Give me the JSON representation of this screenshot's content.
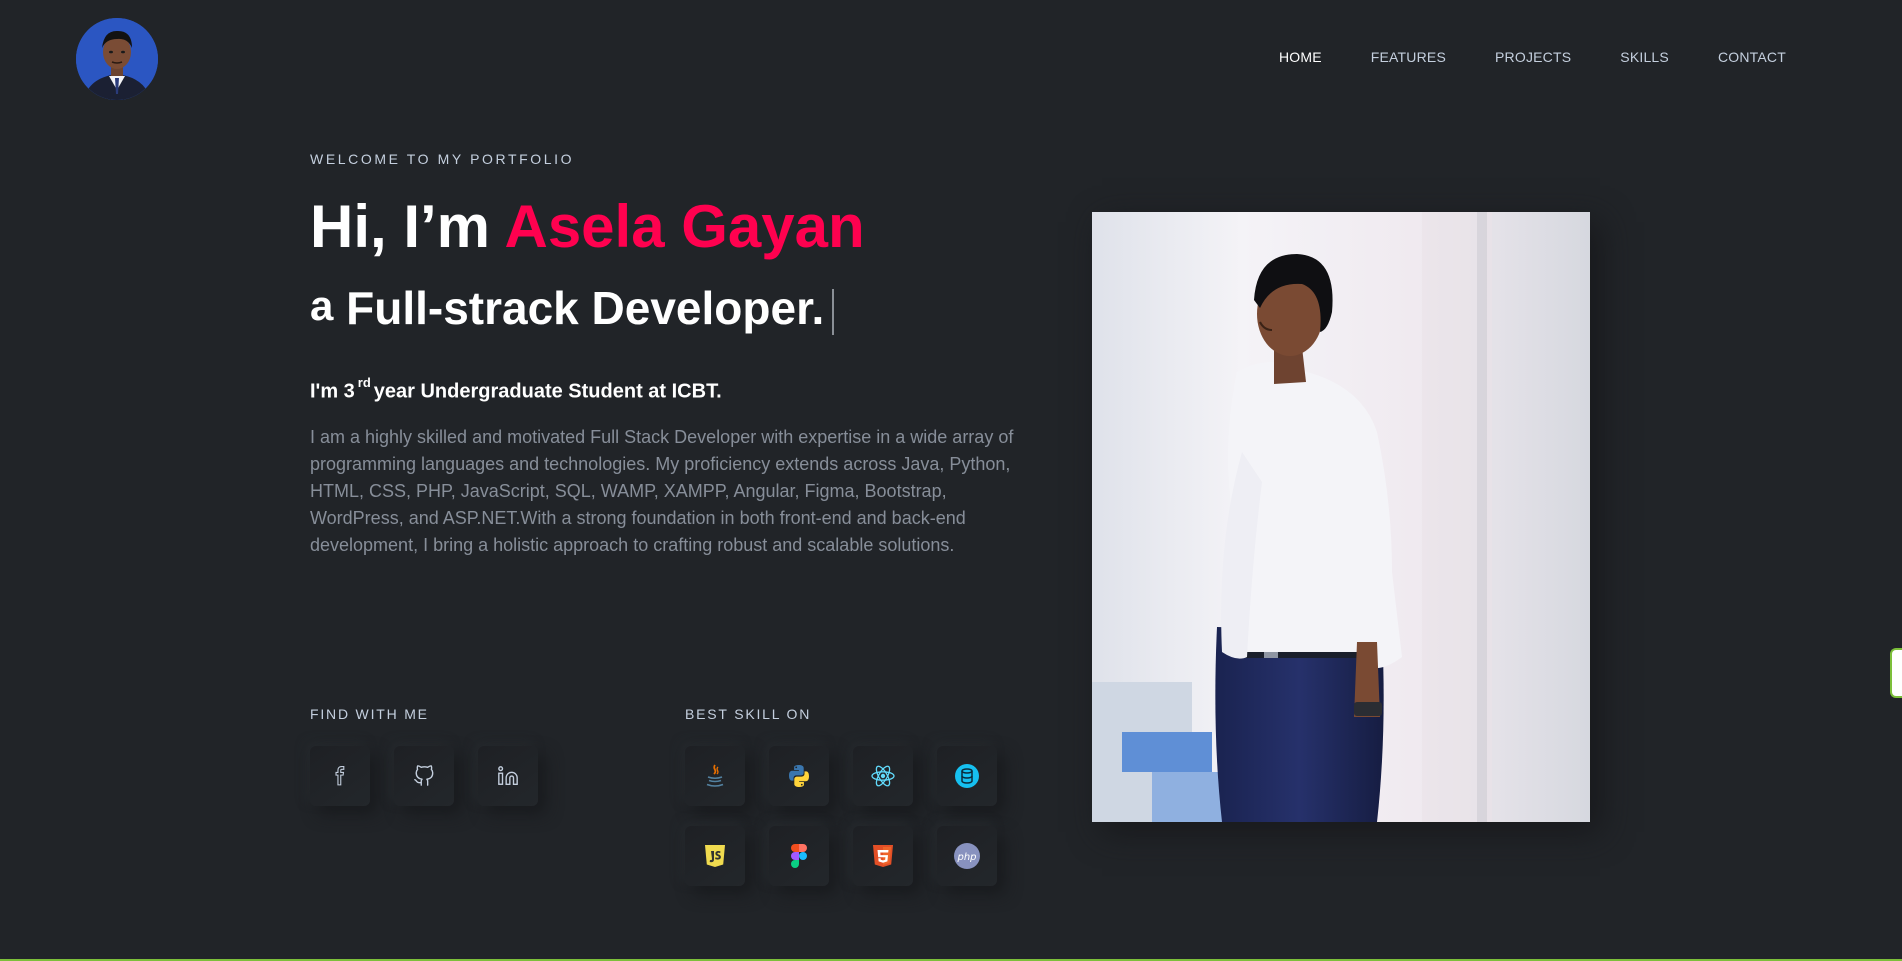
{
  "header": {
    "nav": [
      {
        "label": "HOME",
        "active": true
      },
      {
        "label": "FEATURES",
        "active": false
      },
      {
        "label": "PROJECTS",
        "active": false
      },
      {
        "label": "SKILLS",
        "active": false
      },
      {
        "label": "CONTACT",
        "active": false
      }
    ]
  },
  "hero": {
    "welcome": "WELCOME TO MY PORTFOLIO",
    "greeting": "Hi, I’m",
    "name": "Asela Gayan",
    "role_prefix": "a",
    "role": "Full-strack Developer.",
    "subhead_before": "I'm 3",
    "subhead_sup": "rd",
    "subhead_after": "year Undergraduate Student at ICBT.",
    "bio": "I am a highly skilled and motivated Full Stack Developer with expertise in a wide array of programming languages and technologies. My proficiency extends across Java, Python, HTML, CSS, PHP, JavaScript, SQL, WAMP, XAMPP, Angular, Figma, Bootstrap, WordPress, and ASP.NET.With a strong foundation in both front-end and back-end development, I bring a holistic approach to crafting robust and scalable solutions."
  },
  "social": {
    "label": "FIND WITH ME",
    "icons": [
      "facebook-icon",
      "github-icon",
      "linkedin-icon"
    ]
  },
  "skills": {
    "label": "BEST SKILL ON",
    "icons": [
      "java-icon",
      "python-icon",
      "react-icon",
      "database-icon",
      "javascript-icon",
      "figma-icon",
      "html5-icon",
      "php-icon"
    ],
    "php_text": "php"
  },
  "colors": {
    "background": "#212428",
    "accent": "#ff014f",
    "text": "#c4cfde",
    "muted": "#878e99"
  }
}
